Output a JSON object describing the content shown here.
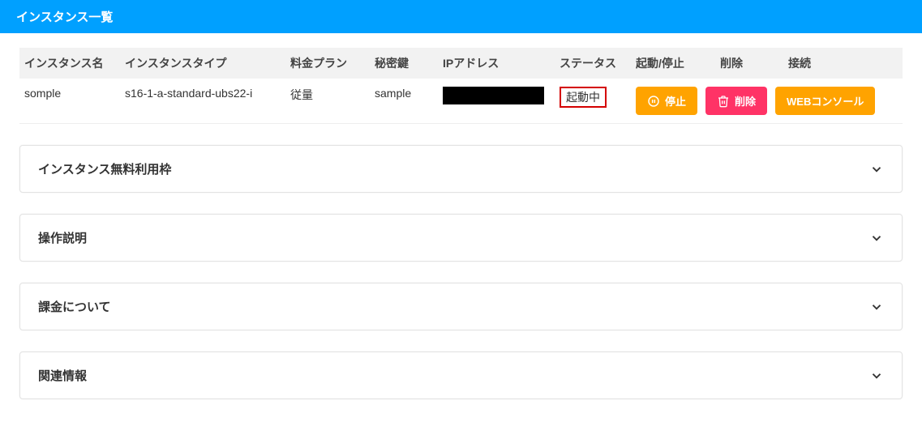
{
  "header": {
    "title": "インスタンス一覧"
  },
  "table": {
    "headers": {
      "instance_name": "インスタンス名",
      "instance_type": "インスタンスタイプ",
      "plan": "料金プラン",
      "secret_key": "秘密鍵",
      "ip_address": "IPアドレス",
      "status": "ステータス",
      "start_stop": "起動/停止",
      "delete": "削除",
      "connect": "接続"
    },
    "rows": [
      {
        "instance_name": "somple",
        "instance_type": "s16-1-a-standard-ubs22-i",
        "plan": "従量",
        "secret_key": "sample",
        "ip_address": "",
        "ip_redacted": true,
        "status": "起動中",
        "actions": {
          "stop_label": "停止",
          "delete_label": "削除",
          "console_label": "WEBコンソール"
        }
      }
    ]
  },
  "accordions": [
    {
      "title": "インスタンス無料利用枠"
    },
    {
      "title": "操作説明"
    },
    {
      "title": "課金について"
    },
    {
      "title": "関連情報"
    }
  ]
}
